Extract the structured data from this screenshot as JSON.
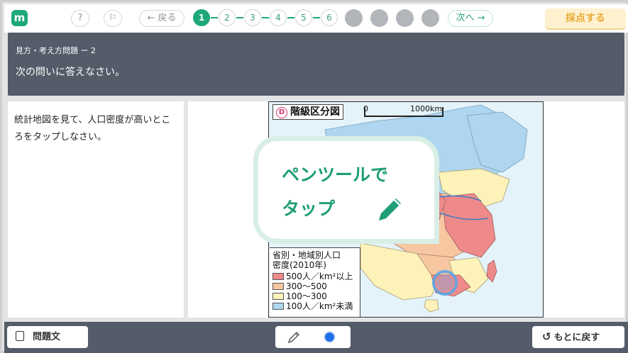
{
  "topbar": {
    "logo": "m",
    "help_label": "?",
    "flag_label": "⚐",
    "back_label": "← 戻る",
    "steps": [
      "1",
      "2",
      "3",
      "4",
      "5",
      "6"
    ],
    "active_step": "1",
    "next_label": "次へ →",
    "score_label": "採点する"
  },
  "header": {
    "subtitle": "見方・考え方問題 ー 2",
    "title": "次の問いに答えなさい。"
  },
  "question": {
    "text": "統計地図を見て、人口密度が高いところをタップしなさい。"
  },
  "map": {
    "badge": "D",
    "title": "階級区分図",
    "scale_zero": "0",
    "scale_label": "1000km",
    "legend_title_1": "省別・地域別人口",
    "legend_title_2": "密度(2010年)",
    "legend": [
      {
        "label": "500人／km²以上",
        "color": "#ef8a8a"
      },
      {
        "label": "300〜500",
        "color": "#f7c7a1"
      },
      {
        "label": "100〜300",
        "color": "#fdf2b9"
      },
      {
        "label": "100人／km²未満",
        "color": "#aed6f0"
      }
    ]
  },
  "overlay": {
    "line1": "ペンツールで",
    "line2": "タップ"
  },
  "bottombar": {
    "problem_label": "問題文",
    "revert_label": "もとに戻す",
    "pen_color": "#1f6fe8"
  }
}
